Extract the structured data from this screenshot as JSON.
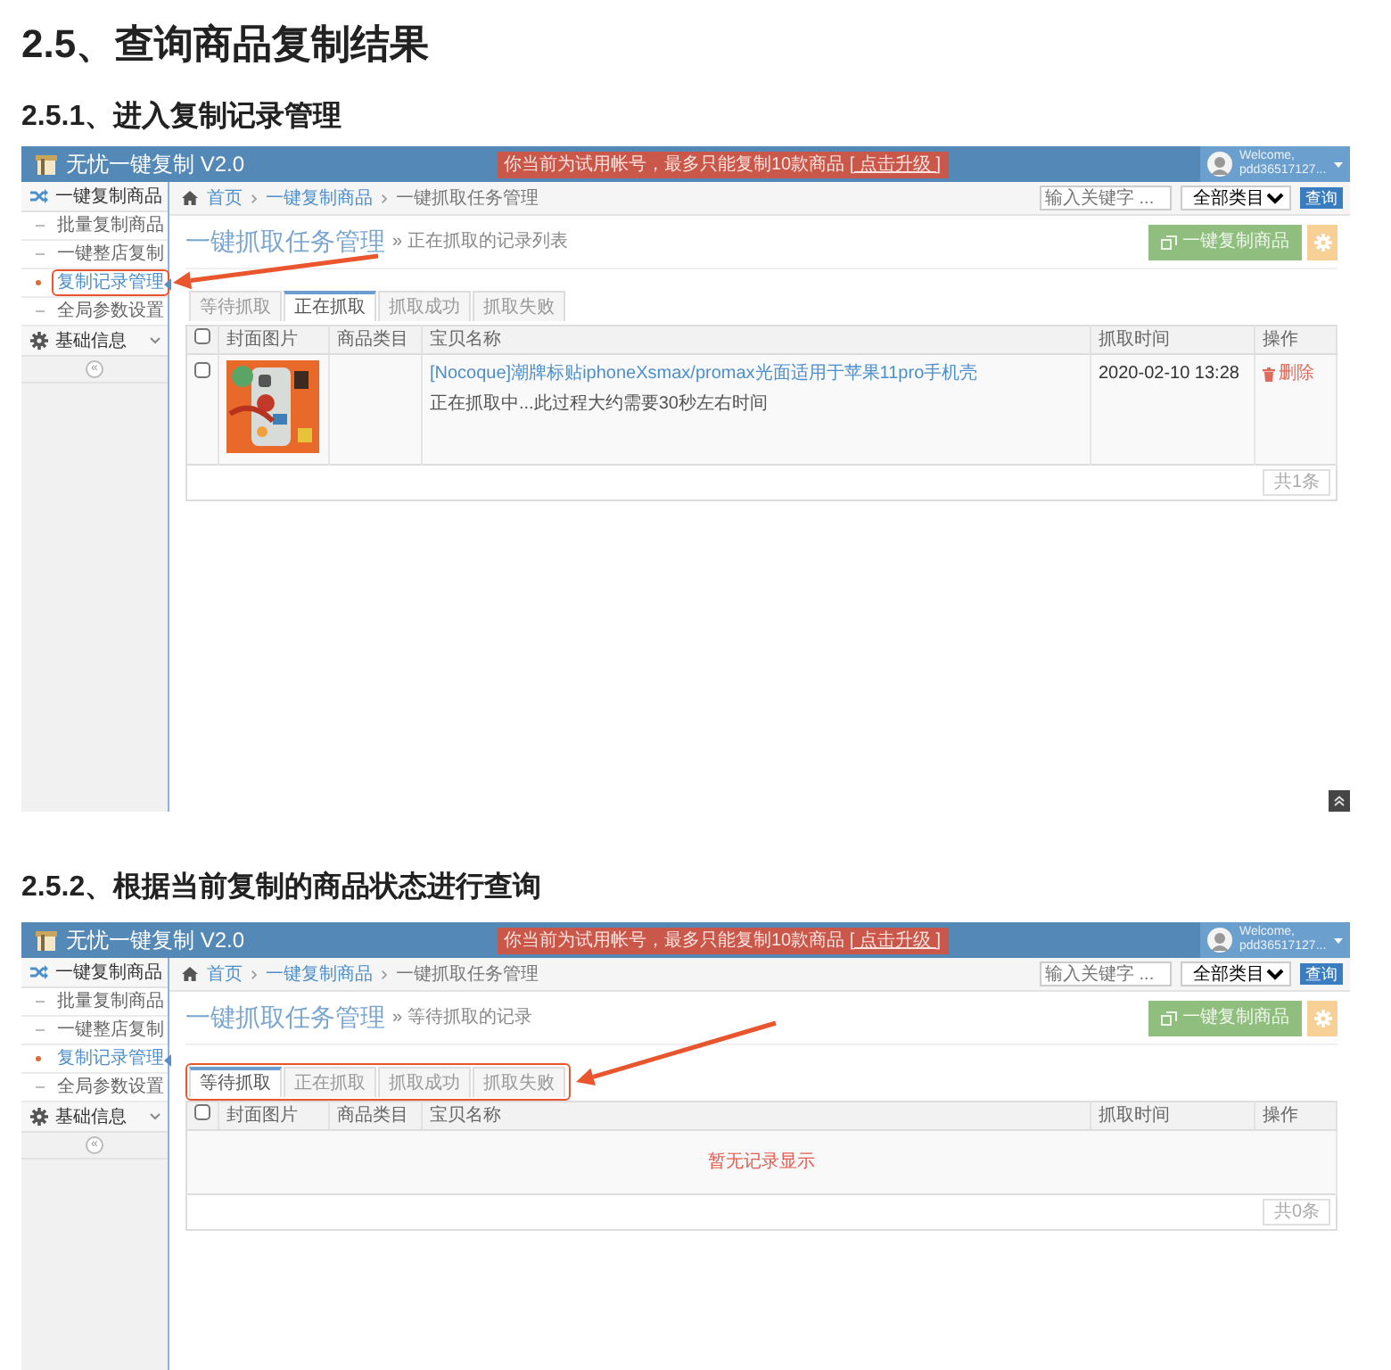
{
  "title": "2.5、查询商品复制结果",
  "sections": [
    {
      "heading": "2.5.1、进入复制记录管理",
      "app": {
        "brand": "无忧一键复制 V2.0",
        "notice": "你当前为试用帐号，最多只能复制10款商品",
        "upgrade_link": "[ 点击升级 ]",
        "welcome": "Welcome,",
        "user": "pdd36517127...",
        "sidebar": [
          {
            "label": "一键复制商品",
            "children": [
              {
                "label": "批量复制商品",
                "selected": false,
                "callout": false
              },
              {
                "label": "一键整店复制",
                "selected": false,
                "callout": false
              },
              {
                "label": "复制记录管理",
                "selected": true,
                "callout": true
              },
              {
                "label": "全局参数设置",
                "selected": false,
                "callout": false
              }
            ]
          },
          {
            "label": "基础信息"
          }
        ],
        "breadcrumb": [
          "首页",
          "一键复制商品",
          "一键抓取任务管理"
        ],
        "search": {
          "placeholder": "输入关键字 ...",
          "category": "全部类目",
          "button": "查询"
        },
        "page_title": "一键抓取任务管理",
        "page_subtitle": "» 正在抓取的记录列表",
        "copy_button": "一键复制商品",
        "tabs_callout": false,
        "tabs": [
          {
            "label": "等待抓取",
            "selected": false
          },
          {
            "label": "正在抓取",
            "selected": true
          },
          {
            "label": "抓取成功",
            "selected": false
          },
          {
            "label": "抓取失败",
            "selected": false
          }
        ],
        "table": {
          "select_all": false,
          "columns": [
            "封面图片",
            "商品类目",
            "宝贝名称",
            "抓取时间",
            "操作"
          ],
          "rows": [
            {
              "checked": false,
              "title": "[Nocoque]潮牌标贴iphoneXsmax/promax光面适用于苹果11pro手机壳",
              "note": "正在抓取中...此过程大约需要30秒左右时间",
              "time": "2020-02-10 13:28",
              "action": "删除"
            }
          ],
          "total": "共1条"
        },
        "collapse_label": "«",
        "scroll_top_button": true
      }
    },
    {
      "heading": "2.5.2、根据当前复制的商品状态进行查询",
      "app": {
        "brand": "无忧一键复制 V2.0",
        "notice": "你当前为试用帐号，最多只能复制10款商品",
        "upgrade_link": "[ 点击升级 ]",
        "welcome": "Welcome,",
        "user": "pdd36517127...",
        "sidebar": [
          {
            "label": "一键复制商品",
            "children": [
              {
                "label": "批量复制商品",
                "selected": false,
                "callout": false
              },
              {
                "label": "一键整店复制",
                "selected": false,
                "callout": false
              },
              {
                "label": "复制记录管理",
                "selected": true,
                "callout": false
              },
              {
                "label": "全局参数设置",
                "selected": false,
                "callout": false
              }
            ]
          },
          {
            "label": "基础信息"
          }
        ],
        "breadcrumb": [
          "首页",
          "一键复制商品",
          "一键抓取任务管理"
        ],
        "search": {
          "placeholder": "输入关键字 ...",
          "category": "全部类目",
          "button": "查询"
        },
        "page_title": "一键抓取任务管理",
        "page_subtitle": "» 等待抓取的记录",
        "copy_button": "一键复制商品",
        "tabs_callout": true,
        "tabs": [
          {
            "label": "等待抓取",
            "selected": true
          },
          {
            "label": "正在抓取",
            "selected": false
          },
          {
            "label": "抓取成功",
            "selected": false
          },
          {
            "label": "抓取失败",
            "selected": false
          }
        ],
        "table": {
          "select_all": false,
          "columns": [
            "封面图片",
            "商品类目",
            "宝贝名称",
            "抓取时间",
            "操作"
          ],
          "empty_text": "暂无记录显示",
          "total": "共0条"
        },
        "collapse_label": "«"
      }
    }
  ]
}
